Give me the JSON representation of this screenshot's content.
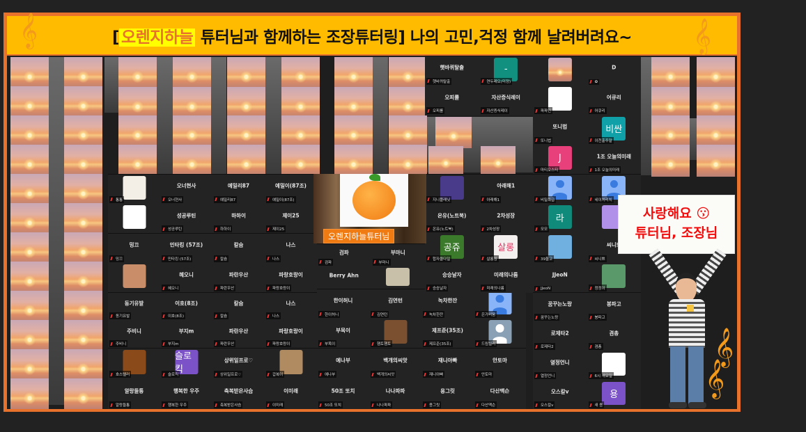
{
  "banner": {
    "highlight": "오렌지하늘",
    "title_rest": " 튜터님과 함께하는 조장튜터링] 나의 고민,걱정 함께 날려버려요~",
    "open_bracket": "["
  },
  "tutor": {
    "name": "오렌지하늘튜터님"
  },
  "sign": {
    "line1": "사랑해요 😗",
    "line2": "튜터님, 조장님"
  },
  "colors": {
    "frame": "#e8712c",
    "banner": "#ffbb00",
    "highlight": "#ffff00",
    "sign_text": "#f20d0d",
    "muted_mic": "#ee3333"
  },
  "panels": [
    {
      "cols": 4,
      "cells": [
        {
          "tile": {
            "type": "img",
            "color": "#f3efe6"
          },
          "label": "통통"
        },
        {
          "name": "오너현사",
          "label": "오너현사"
        },
        {
          "name": "예밀리87",
          "label": "예밀리87"
        },
        {
          "name": "예밀이(87조)",
          "label": "예밀이(87조)"
        },
        {
          "tile": {
            "type": "img",
            "color": "#ffffff"
          },
          "label": ""
        },
        {
          "name": "성공루틴",
          "label": "성공루틴"
        },
        {
          "name": "하하이",
          "label": "하하이"
        },
        {
          "name": "제이25",
          "label": "제이25"
        }
      ]
    },
    {
      "cols": 4,
      "cells": [
        {
          "name": "밍끄",
          "label": "밍끄"
        },
        {
          "name": "민타킹 (57조)",
          "label": "민타킹 (57조)"
        },
        {
          "name": "칼슘",
          "label": "칼슘"
        },
        {
          "name": "나스",
          "label": "나스"
        },
        {
          "tile": {
            "type": "img",
            "color": "#c98d6a"
          },
          "label": ""
        },
        {
          "name": "혜오니",
          "label": "혜오니"
        },
        {
          "name": "파란우산",
          "label": "파란우산"
        },
        {
          "name": "파랑호랑이",
          "label": "파랑호랑이"
        }
      ]
    },
    {
      "cols": 4,
      "cells": [
        {
          "name": "동기유발",
          "label": "동기유발"
        },
        {
          "name": "이호(8조)",
          "label": "이호(8조)"
        },
        {
          "name": "칼슘",
          "label": "칼슘"
        },
        {
          "name": "나스",
          "label": "나스"
        },
        {
          "name": "주비니",
          "label": "주비니"
        },
        {
          "name": "부지m",
          "label": "부지m"
        },
        {
          "name": "파란우산",
          "label": "파란우산"
        },
        {
          "name": "파랑호랑이",
          "label": "파랑호랑이"
        }
      ]
    },
    {
      "cols": 4,
      "cells": [
        {
          "tile": {
            "type": "img",
            "color": "#8a4a1a"
          },
          "label": "호스텔러"
        },
        {
          "tile": {
            "type": "letter",
            "text": "슬로킥",
            "color": "#7b52c8"
          },
          "label": "슬로킥"
        },
        {
          "name": "상위일프로♡",
          "label": "상위일프로♡"
        },
        {
          "tile": {
            "type": "img",
            "color": "#b08a60"
          },
          "label": "갑복이"
        },
        {
          "name": "알랑들통",
          "label": "알랑들통"
        },
        {
          "name": "행복한 우주",
          "label": "행복한 우주"
        },
        {
          "name": "축복받은사슴",
          "label": "축복받은사슴"
        },
        {
          "name": "이미래",
          "label": "이미래"
        }
      ]
    },
    {
      "cols": 2,
      "cells": [
        {
          "name": "검파",
          "label": "검파"
        },
        {
          "name": "부마니",
          "label": "부마니"
        },
        {
          "name": "Berry Ahn",
          "label": ""
        },
        {
          "tile": {
            "type": "img",
            "color": "#c8c0a8"
          },
          "label": ""
        }
      ]
    },
    {
      "cols": 4,
      "cells": [
        {
          "name": "한이허니",
          "label": "한이허니"
        },
        {
          "name": "김연턴",
          "label": "김연턴"
        },
        {
          "name": "녹차한잔",
          "label": "녹차한잔"
        },
        {
          "tile": {
            "type": "avatar"
          },
          "label": "은가비움"
        },
        {
          "name": "부목이",
          "label": "부목이"
        },
        {
          "tile": {
            "type": "img",
            "color": "#7a5030"
          },
          "label": "햄토햄토"
        },
        {
          "name": "제프준(35조)",
          "label": "제프준(35조)"
        },
        {
          "tile": {
            "type": "grey"
          },
          "label": "드림빌러"
        }
      ]
    },
    {
      "cols": 4,
      "cells": [
        {
          "name": "예나부",
          "label": "예나부"
        },
        {
          "name": "백개의씨앗",
          "label": "백개의씨앗"
        },
        {
          "name": "재니아빠",
          "label": "재니아빠"
        },
        {
          "name": "안토마",
          "label": "안토마"
        },
        {
          "name": "50조 또치",
          "label": "50조 또치"
        },
        {
          "name": "나나파파",
          "label": "나나파파"
        },
        {
          "name": "용그릿",
          "label": "용그릿"
        },
        {
          "name": "다산맥슨",
          "label": "다산맥슨"
        }
      ]
    },
    {
      "cols": 2,
      "cells": [
        {
          "tile": {
            "type": "img",
            "color": "#4a3a8a"
          },
          "label": "지니플래닛"
        },
        {
          "name": "아래해1",
          "label": "아래해1"
        },
        {
          "name": "온유(노트북)",
          "label": "온유(노트북)"
        },
        {
          "name": "2차성장",
          "label": "2차성장"
        },
        {
          "tile": {
            "type": "letter",
            "text": "공쥬",
            "color": "#3a7a2a"
          },
          "label": "합자울다일"
        },
        {
          "tile": {
            "type": "letter",
            "text": "살롱",
            "color": "#f5f0f0"
          },
          "label": "살롱링"
        },
        {
          "name": "승승날자",
          "label": "승승날자"
        },
        {
          "name": "미래의나룸",
          "label": "미래의나룸"
        }
      ]
    },
    {
      "cols": 2,
      "cells": [
        {
          "name": "햇바퀴탈출",
          "label": "햇바퀴탈출"
        },
        {
          "tile": {
            "type": "letter",
            "text": "-",
            "color": "#119080"
          },
          "label": "연두레오(미정)"
        },
        {
          "name": "오피롤",
          "label": "오피롤"
        },
        {
          "name": "자산증식레이",
          "label": "자산증식레이"
        }
      ]
    },
    {
      "cols": 2,
      "cells": [
        {
          "tile": {
            "type": "sun"
          },
          "label": ""
        },
        {
          "name": "D",
          "label": "✿"
        },
        {
          "tile": {
            "type": "img",
            "color": "#ffffff"
          },
          "label": "파파인"
        },
        {
          "name": "어큐리",
          "label": "어큐리"
        },
        {
          "name": "또니법",
          "label": "또니법"
        },
        {
          "tile": {
            "type": "letter",
            "text": "비싼",
            "color": "#10a0a8"
          },
          "label": "이천출주말"
        },
        {
          "tile": {
            "type": "letter",
            "text": "J",
            "color": "#e8407a"
          },
          "label": "마티오스타"
        },
        {
          "name": "1조 오늘의미래",
          "label": "1조 오늘의미래"
        }
      ]
    },
    {
      "cols": 2,
      "cells": [
        {
          "tile": {
            "type": "avatar"
          },
          "label": "비밀특급"
        },
        {
          "tile": {
            "type": "avatar"
          },
          "label": "네이처리치"
        },
        {
          "tile": {
            "type": "letter",
            "text": "라",
            "color": "#108a7a"
          },
          "label": "모모"
        },
        {
          "tile": {
            "type": "img",
            "color": "#b090e8"
          },
          "label": ""
        },
        {
          "tile": {
            "type": "img",
            "color": "#70b0e0"
          },
          "label": "39돌고"
        },
        {
          "name": "씨니쁘",
          "label": "씨니쁘"
        },
        {
          "name": "JJeoN",
          "label": "JJeoN"
        },
        {
          "tile": {
            "type": "img",
            "color": "#5a9a6a"
          },
          "label": "정정이"
        }
      ]
    },
    {
      "cols": 2,
      "cells": [
        {
          "name": "꿈꾸는노랑",
          "label": "꿈꾸는노랑"
        },
        {
          "name": "봉파고",
          "label": "봉파고"
        },
        {
          "name": "로제타2",
          "label": "로제타2"
        },
        {
          "name": "겸총",
          "label": "겸총"
        },
        {
          "name": "열정언니",
          "label": "열정언니"
        },
        {
          "tile": {
            "type": "img",
            "color": "#ffffff"
          },
          "label": "6시 새요일"
        },
        {
          "name": "오스칼v",
          "label": "오스칼v"
        },
        {
          "tile": {
            "type": "letter",
            "text": "용",
            "color": "#7b52c8"
          },
          "label": "새 용"
        }
      ]
    }
  ]
}
